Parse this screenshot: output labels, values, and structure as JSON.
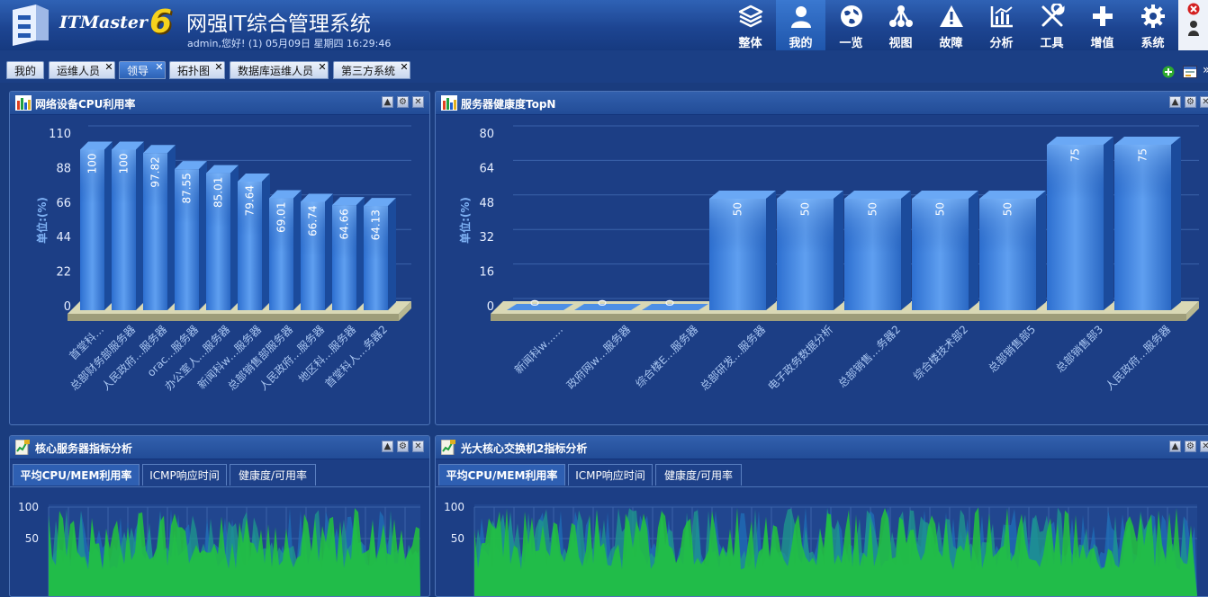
{
  "app": {
    "logo_text": "ITMaster",
    "logo_version": "6",
    "title": "网强IT综合管理系统",
    "welcome": "admin,您好! (1) 05月09日 星期四 16:29:46"
  },
  "nav": [
    {
      "label": "整体",
      "icon": "layers-icon"
    },
    {
      "label": "我的",
      "icon": "user-icon",
      "active": true
    },
    {
      "label": "一览",
      "icon": "globe-icon"
    },
    {
      "label": "视图",
      "icon": "topology-icon"
    },
    {
      "label": "故障",
      "icon": "warning-icon"
    },
    {
      "label": "分析",
      "icon": "chart-icon"
    },
    {
      "label": "工具",
      "icon": "tools-icon"
    },
    {
      "label": "增值",
      "icon": "plus-icon"
    },
    {
      "label": "系统",
      "icon": "gear-icon"
    }
  ],
  "tabs": [
    {
      "label": "我的",
      "closable": false
    },
    {
      "label": "运维人员",
      "closable": true
    },
    {
      "label": "领导",
      "closable": true,
      "active": true
    },
    {
      "label": "拓扑图",
      "closable": true
    },
    {
      "label": "数据库运维人员",
      "closable": true
    },
    {
      "label": "第三方系统",
      "closable": true
    }
  ],
  "panels": {
    "cpu": {
      "title": "网络设备CPU利用率"
    },
    "health": {
      "title": "服务器健康度TopN"
    },
    "core": {
      "title": "核心服务器指标分析",
      "subtabs": [
        "平均CPU/MEM利用率",
        "ICMP响应时间",
        "健康度/可用率"
      ]
    },
    "switch": {
      "title": "光大核心交换机2指标分析",
      "subtabs": [
        "平均CPU/MEM利用率",
        "ICMP响应时间",
        "健康度/可用率"
      ]
    }
  },
  "chart_data": [
    {
      "type": "bar",
      "title": "网络设备CPU利用率",
      "ylabel": "单位:(%)",
      "ylim": [
        0,
        110
      ],
      "yticks": [
        0,
        22,
        44,
        66,
        88,
        110
      ],
      "categories": [
        "首堂科…",
        "总部财务部服务器",
        "人民政府…服务器",
        "orac…服务器",
        "办公室人…服务器",
        "新闻科w…服务器",
        "总部销售部服务器",
        "人民政府…服务器",
        "地区科…服务器",
        "首堂科人…务器2"
      ],
      "values": [
        100,
        100,
        97.82,
        87.55,
        85.01,
        79.64,
        69.01,
        66.74,
        64.66,
        64.13
      ],
      "labels": [
        "100",
        "100",
        "97.82",
        "87.55",
        "85.01",
        "79.64",
        "69.01",
        "66.74",
        "64.66",
        "64.13"
      ]
    },
    {
      "type": "bar",
      "title": "服务器健康度TopN",
      "ylabel": "单位:(%)",
      "ylim": [
        0,
        80
      ],
      "yticks": [
        0,
        16,
        32,
        48,
        64,
        80
      ],
      "categories": [
        "新闻科w……",
        "政府网w…服务器",
        "综合楼E…服务器",
        "总部研发…服务器",
        "电子政务数据分析",
        "总部销售…务器2",
        "综合楼技术部2",
        "总部销售部5",
        "总部销售部3",
        "人民政府…服务器"
      ],
      "values": [
        0,
        0,
        0,
        50,
        50,
        50,
        50,
        50,
        75,
        75
      ],
      "labels": [
        "0",
        "0",
        "0",
        "50",
        "50",
        "50",
        "50",
        "50",
        "75",
        "75"
      ]
    },
    {
      "type": "area",
      "title": "核心服务器指标分析",
      "ylim": [
        0,
        100
      ],
      "yticks": [
        50,
        100
      ],
      "series": []
    },
    {
      "type": "area",
      "title": "光大核心交换机2指标分析",
      "ylim": [
        0,
        100
      ],
      "yticks": [
        50,
        100
      ],
      "series": []
    }
  ]
}
